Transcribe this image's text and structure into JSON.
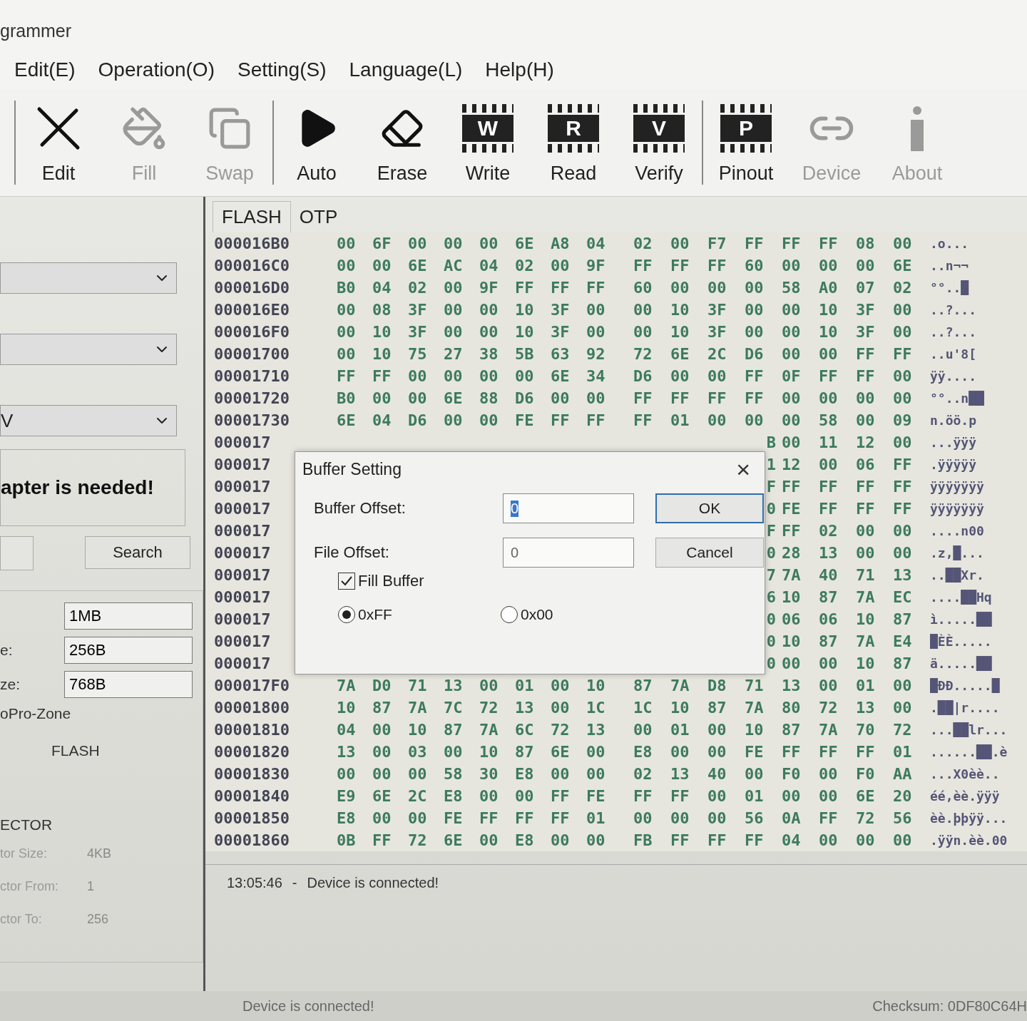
{
  "window": {
    "title": "grammer"
  },
  "menu": [
    "Edit(E)",
    "Operation(O)",
    "Setting(S)",
    "Language(L)",
    "Help(H)"
  ],
  "toolbar": [
    {
      "label": "Edit",
      "kind": "edit",
      "disabled": false
    },
    {
      "label": "Fill",
      "kind": "fill",
      "disabled": true
    },
    {
      "label": "Swap",
      "kind": "swap",
      "disabled": true,
      "separator_after": true
    },
    {
      "label": "Auto",
      "kind": "play",
      "disabled": false
    },
    {
      "label": "Erase",
      "kind": "erase",
      "disabled": false
    },
    {
      "label": "Write",
      "kind": "chip",
      "chip_letter": "W",
      "disabled": false
    },
    {
      "label": "Read",
      "kind": "chip",
      "chip_letter": "R",
      "disabled": false
    },
    {
      "label": "Verify",
      "kind": "chip",
      "chip_letter": "V",
      "disabled": false,
      "separator_after": true
    },
    {
      "label": "Pinout",
      "kind": "chip",
      "chip_letter": "P",
      "disabled": false
    },
    {
      "label": "Device",
      "kind": "link",
      "disabled": true
    },
    {
      "label": "About",
      "kind": "info",
      "disabled": true
    }
  ],
  "left_panel": {
    "dropdowns": [
      {
        "kind": "combo"
      },
      {
        "kind": "combo"
      },
      {
        "kind": "combo",
        "value": "V"
      }
    ],
    "notice": "apter is needed!",
    "search_button": "Search",
    "info_fields": [
      {
        "value": "1MB"
      },
      {
        "label": "e:",
        "value": "256B"
      },
      {
        "label": "ze:",
        "value": "768B"
      }
    ],
    "zone": "oPro-Zone",
    "memory_type": "FLASH",
    "sector": {
      "heading": "ECTOR",
      "disabled": true,
      "rows": [
        {
          "label": "tor Size:",
          "value": "4KB"
        },
        {
          "label": "ctor From:",
          "value": "1"
        },
        {
          "label": "ctor To:",
          "value": "256"
        }
      ]
    }
  },
  "tabs": [
    {
      "label": "FLASH",
      "selected": true
    },
    {
      "label": "OTP",
      "selected": false
    }
  ],
  "hex_rows": [
    {
      "kind": "full",
      "address": "000016B0",
      "bytes": [
        "00",
        "6F",
        "00",
        "00",
        "00",
        "6E",
        "A8",
        "04",
        "02",
        "00",
        "F7",
        "FF",
        "FF",
        "FF",
        "08",
        "00"
      ],
      "ascii": ".o..."
    },
    {
      "kind": "full",
      "address": "000016C0",
      "bytes": [
        "00",
        "00",
        "6E",
        "AC",
        "04",
        "02",
        "00",
        "9F",
        "FF",
        "FF",
        "FF",
        "60",
        "00",
        "00",
        "00",
        "6E"
      ],
      "ascii": "..n¬¬"
    },
    {
      "kind": "full",
      "address": "000016D0",
      "bytes": [
        "B0",
        "04",
        "02",
        "00",
        "9F",
        "FF",
        "FF",
        "FF",
        "60",
        "00",
        "00",
        "00",
        "58",
        "A0",
        "07",
        "02"
      ],
      "ascii": "°°..█"
    },
    {
      "kind": "full",
      "address": "000016E0",
      "bytes": [
        "00",
        "08",
        "3F",
        "00",
        "00",
        "10",
        "3F",
        "00",
        "00",
        "10",
        "3F",
        "00",
        "00",
        "10",
        "3F",
        "00"
      ],
      "ascii": "..?..."
    },
    {
      "kind": "full",
      "address": "000016F0",
      "bytes": [
        "00",
        "10",
        "3F",
        "00",
        "00",
        "10",
        "3F",
        "00",
        "00",
        "10",
        "3F",
        "00",
        "00",
        "10",
        "3F",
        "00"
      ],
      "ascii": "..?..."
    },
    {
      "kind": "full",
      "address": "00001700",
      "bytes": [
        "00",
        "10",
        "75",
        "27",
        "38",
        "5B",
        "63",
        "92",
        "72",
        "6E",
        "2C",
        "D6",
        "00",
        "00",
        "FF",
        "FF"
      ],
      "ascii": "..u'8["
    },
    {
      "kind": "full",
      "address": "00001710",
      "bytes": [
        "FF",
        "FF",
        "00",
        "00",
        "00",
        "00",
        "6E",
        "34",
        "D6",
        "00",
        "00",
        "FF",
        "0F",
        "FF",
        "FF",
        "00"
      ],
      "ascii": "ÿÿ...."
    },
    {
      "kind": "full",
      "address": "00001720",
      "bytes": [
        "B0",
        "00",
        "00",
        "6E",
        "88",
        "D6",
        "00",
        "00",
        "FF",
        "FF",
        "FF",
        "FF",
        "00",
        "00",
        "00",
        "00"
      ],
      "ascii": "°°..n██"
    },
    {
      "kind": "full",
      "address": "00001730",
      "bytes": [
        "6E",
        "04",
        "D6",
        "00",
        "00",
        "FE",
        "FF",
        "FF",
        "FF",
        "01",
        "00",
        "00",
        "00",
        "58",
        "00",
        "09"
      ],
      "ascii": "n.öö.p"
    },
    {
      "kind": "covered",
      "address": "000017",
      "cut": "B",
      "bytes": [
        "00",
        "11",
        "12",
        "00"
      ],
      "ascii": "...ÿÿÿ"
    },
    {
      "kind": "covered",
      "address": "000017",
      "cut": "1",
      "bytes": [
        "12",
        "00",
        "06",
        "FF"
      ],
      "ascii": ".ÿÿÿÿÿ"
    },
    {
      "kind": "covered",
      "address": "000017",
      "cut": "F",
      "bytes": [
        "FF",
        "FF",
        "FF",
        "FF"
      ],
      "ascii": "ÿÿÿÿÿÿÿ"
    },
    {
      "kind": "covered",
      "address": "000017",
      "cut": "0",
      "bytes": [
        "FE",
        "FF",
        "FF",
        "FF"
      ],
      "ascii": "ÿÿÿÿÿÿÿ"
    },
    {
      "kind": "covered",
      "address": "000017",
      "cut": "F",
      "bytes": [
        "FF",
        "02",
        "00",
        "00"
      ],
      "ascii": "....n00"
    },
    {
      "kind": "covered",
      "address": "000017",
      "cut": "0",
      "bytes": [
        "28",
        "13",
        "00",
        "00"
      ],
      "ascii": ".z,█..."
    },
    {
      "kind": "covered",
      "address": "000017",
      "cut": "7",
      "bytes": [
        "7A",
        "40",
        "71",
        "13"
      ],
      "ascii": "..██Xr."
    },
    {
      "kind": "covered",
      "address": "000017",
      "cut": "6",
      "bytes": [
        "10",
        "87",
        "7A",
        "EC"
      ],
      "ascii": "....██Hq"
    },
    {
      "kind": "covered",
      "address": "000017",
      "cut": "0",
      "bytes": [
        "06",
        "06",
        "10",
        "87"
      ],
      "ascii": "ì.....██"
    },
    {
      "kind": "covered",
      "address": "000017",
      "cut": "0",
      "bytes": [
        "10",
        "87",
        "7A",
        "E4"
      ],
      "ascii": "█ÈÈ....."
    },
    {
      "kind": "covered",
      "address": "000017",
      "cut": "0",
      "bytes": [
        "00",
        "00",
        "10",
        "87"
      ],
      "ascii": "ä.....██"
    },
    {
      "kind": "full",
      "address": "000017F0",
      "bytes": [
        "7A",
        "D0",
        "71",
        "13",
        "00",
        "01",
        "00",
        "10",
        "87",
        "7A",
        "D8",
        "71",
        "13",
        "00",
        "01",
        "00"
      ],
      "ascii": "█ÐÐ.....█"
    },
    {
      "kind": "full",
      "address": "00001800",
      "bytes": [
        "10",
        "87",
        "7A",
        "7C",
        "72",
        "13",
        "00",
        "1C",
        "1C",
        "10",
        "87",
        "7A",
        "80",
        "72",
        "13",
        "00"
      ],
      "ascii": ".██|r...."
    },
    {
      "kind": "full",
      "address": "00001810",
      "bytes": [
        "04",
        "00",
        "10",
        "87",
        "7A",
        "6C",
        "72",
        "13",
        "00",
        "01",
        "00",
        "10",
        "87",
        "7A",
        "70",
        "72"
      ],
      "ascii": "...██lr..."
    },
    {
      "kind": "full",
      "address": "00001820",
      "bytes": [
        "13",
        "00",
        "03",
        "00",
        "10",
        "87",
        "6E",
        "00",
        "E8",
        "00",
        "00",
        "FE",
        "FF",
        "FF",
        "FF",
        "01"
      ],
      "ascii": "......██.è"
    },
    {
      "kind": "full",
      "address": "00001830",
      "bytes": [
        "00",
        "00",
        "00",
        "58",
        "30",
        "E8",
        "00",
        "00",
        "02",
        "13",
        "40",
        "00",
        "F0",
        "00",
        "F0",
        "AA"
      ],
      "ascii": "...X0èè.."
    },
    {
      "kind": "full",
      "address": "00001840",
      "bytes": [
        "E9",
        "6E",
        "2C",
        "E8",
        "00",
        "00",
        "FF",
        "FE",
        "FF",
        "FF",
        "00",
        "01",
        "00",
        "00",
        "6E",
        "20"
      ],
      "ascii": "éé,èè.ÿÿÿ"
    },
    {
      "kind": "full",
      "address": "00001850",
      "bytes": [
        "E8",
        "00",
        "00",
        "FE",
        "FF",
        "FF",
        "FF",
        "01",
        "00",
        "00",
        "00",
        "56",
        "0A",
        "FF",
        "72",
        "56"
      ],
      "ascii": "èè.þþÿÿ..."
    },
    {
      "kind": "full",
      "address": "00001860",
      "bytes": [
        "0B",
        "FF",
        "72",
        "6E",
        "00",
        "E8",
        "00",
        "00",
        "FB",
        "FF",
        "FF",
        "FF",
        "04",
        "00",
        "00",
        "00"
      ],
      "ascii": ".ÿÿn.èè.00"
    }
  ],
  "log": [
    {
      "time": "13:05:46",
      "separator": "-",
      "message": "Device is connected!"
    }
  ],
  "status_bar": {
    "message": "Device is connected!",
    "checksum": "Checksum: 0DF80C64H"
  },
  "dialog": {
    "title": "Buffer Setting",
    "close": "×",
    "fields": [
      {
        "label": "Buffer Offset:",
        "value": "0",
        "selected": true
      },
      {
        "label": "File Offset:",
        "value": "0",
        "selected": false
      }
    ],
    "buttons": [
      {
        "label": "OK",
        "default": true
      },
      {
        "label": "Cancel",
        "default": false
      }
    ],
    "fill_buffer": {
      "label": "Fill Buffer",
      "checked": true
    },
    "fill_values": [
      {
        "label": "0xFF",
        "selected": true
      },
      {
        "label": "0x00",
        "selected": false
      }
    ]
  }
}
